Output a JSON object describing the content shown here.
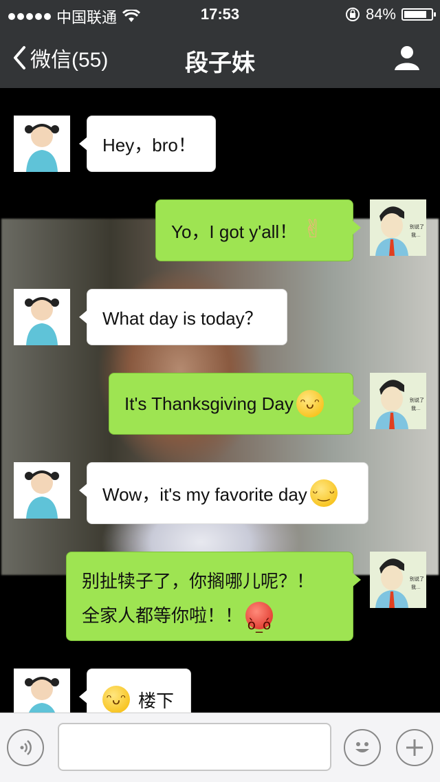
{
  "status_bar": {
    "carrier": "中国联通",
    "time": "17:53",
    "battery": "84%",
    "battery_level": 0.84
  },
  "nav": {
    "back_label": "微信(55)",
    "title": "段子妹"
  },
  "messages": [
    {
      "side": "in",
      "text": "Hey，bro！"
    },
    {
      "side": "out",
      "text": "Yo，I got y'all！",
      "emoji": "rock-hand-emoji"
    },
    {
      "side": "in",
      "text": "What day is today？"
    },
    {
      "side": "out",
      "text": "It's Thanksgiving Day",
      "emoji": "grin-emoji"
    },
    {
      "side": "in",
      "text": "Wow，it's my favorite day",
      "emoji": "smile-emoji"
    },
    {
      "side": "out",
      "lines": [
        "别扯犊子了，你搁哪儿呢？！",
        "全家人都等你啦！！"
      ],
      "emoji": "angry-emoji"
    },
    {
      "side": "in",
      "text": "楼下",
      "emoji": "grin-emoji"
    }
  ],
  "avatar_caption": "别说了，我。。。",
  "colors": {
    "bar": "#333537",
    "out_bubble": "#9ee452",
    "in_bubble": "#ffffff"
  }
}
